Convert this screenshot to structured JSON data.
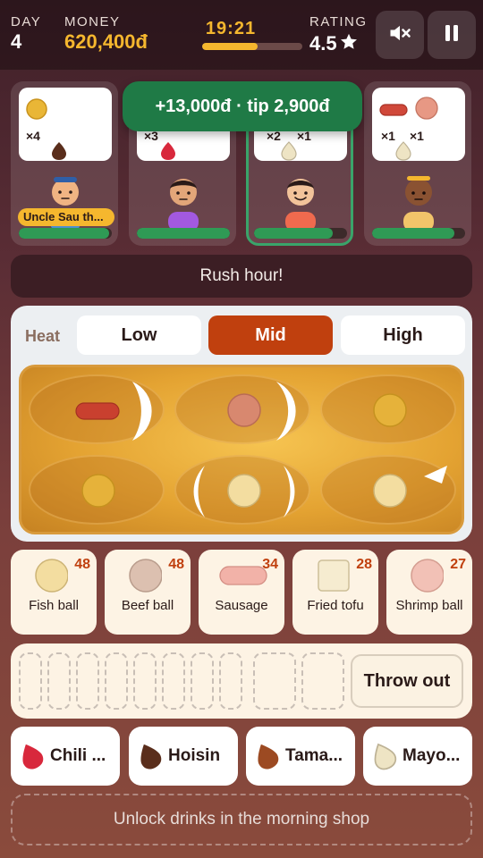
{
  "hud": {
    "day_label": "DAY",
    "day_value": "4",
    "money_label": "MONEY",
    "money_value": "620,400đ",
    "timer": "19:21",
    "timer_progress": 0.55,
    "rating_label": "RATING",
    "rating_value": "4.5",
    "mute_icon": "speaker-muted-icon",
    "pause_icon": "pause-icon"
  },
  "customers": [
    {
      "order_count": "×4",
      "name_tag": "Uncle Sau th...",
      "patience": 0.97,
      "sauce": "hoisin",
      "skin": "#f0b483",
      "shirt": "#4e8fd0"
    },
    {
      "order_count": "×3",
      "patience": 1.0,
      "sauce": "chili",
      "skin": "#e3a679",
      "shirt": "#a259e0"
    },
    {
      "order_count_a": "×2",
      "order_count_b": "×1",
      "patience": 0.85,
      "sauce": "mayo",
      "skin": "#f2c39a",
      "shirt": "#ef6a4e",
      "selected": true
    },
    {
      "order_count_a": "×1",
      "order_count_b": "×1",
      "patience": 0.88,
      "sauce": "mayo",
      "skin": "#8a5232",
      "shirt": "#f2c46a"
    }
  ],
  "toast": "+13,000đ · tip 2,900đ",
  "banner": "Rush hour!",
  "heat": {
    "label": "Heat",
    "options": [
      "Low",
      "Mid",
      "High"
    ],
    "selected": "Mid"
  },
  "ingredients": [
    {
      "name": "Fish ball",
      "count": "48"
    },
    {
      "name": "Beef ball",
      "count": "48"
    },
    {
      "name": "Sausage",
      "count": "34"
    },
    {
      "name": "Fried tofu",
      "count": "28"
    },
    {
      "name": "Shrimp ball",
      "count": "27"
    }
  ],
  "tray": {
    "throw_out": "Throw out"
  },
  "sauces": [
    {
      "name": "Chili ...",
      "color": "#d8283c"
    },
    {
      "name": "Hoisin",
      "color": "#5a2e1c"
    },
    {
      "name": "Tama...",
      "color": "#9c4a22"
    },
    {
      "name": "Mayo...",
      "color": "#eee4c4"
    }
  ],
  "unlock_text": "Unlock drinks in the morning shop",
  "colors": {
    "accent": "#c0400e",
    "gold": "#f5b72e",
    "success": "#1f7a46"
  }
}
